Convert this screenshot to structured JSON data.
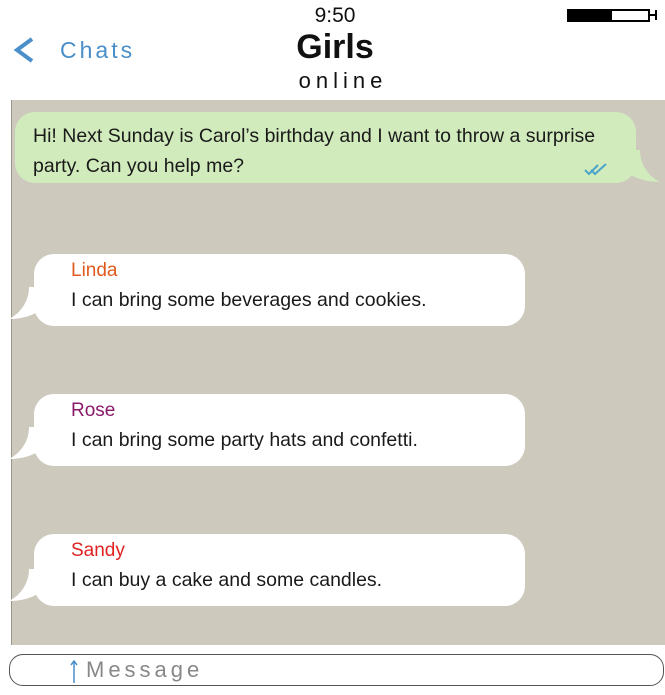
{
  "status_bar": {
    "time": "9:50",
    "battery_level": 0.55
  },
  "header": {
    "back_label": "Chats",
    "back_icon": "chevron-left-icon",
    "title": "Girls",
    "status": "online"
  },
  "messages": [
    {
      "direction": "outgoing",
      "text": "Hi! Next Sunday is Carol’s birthday and I want to throw a surprise party. Can you help me?",
      "read_receipt_icon": "double-check-icon"
    },
    {
      "direction": "incoming",
      "sender": "Linda",
      "text": "I can bring some beverages and cookies."
    },
    {
      "direction": "incoming",
      "sender": "Rose",
      "text": "I can bring some party hats and confetti."
    },
    {
      "direction": "incoming",
      "sender": "Sandy",
      "text": "I can buy a cake and some candles."
    }
  ],
  "composer": {
    "placeholder": "Message"
  },
  "colors": {
    "accent": "#4a8fc9",
    "chat_background": "#cdc9bd",
    "outgoing_bubble": "#d1ebbd",
    "incoming_bubble": "#ffffff",
    "sender_linda": "#e05a1e",
    "sender_rose": "#8a1a6a",
    "sender_sandy": "#e02222",
    "read_receipt": "#4aa3c9"
  }
}
